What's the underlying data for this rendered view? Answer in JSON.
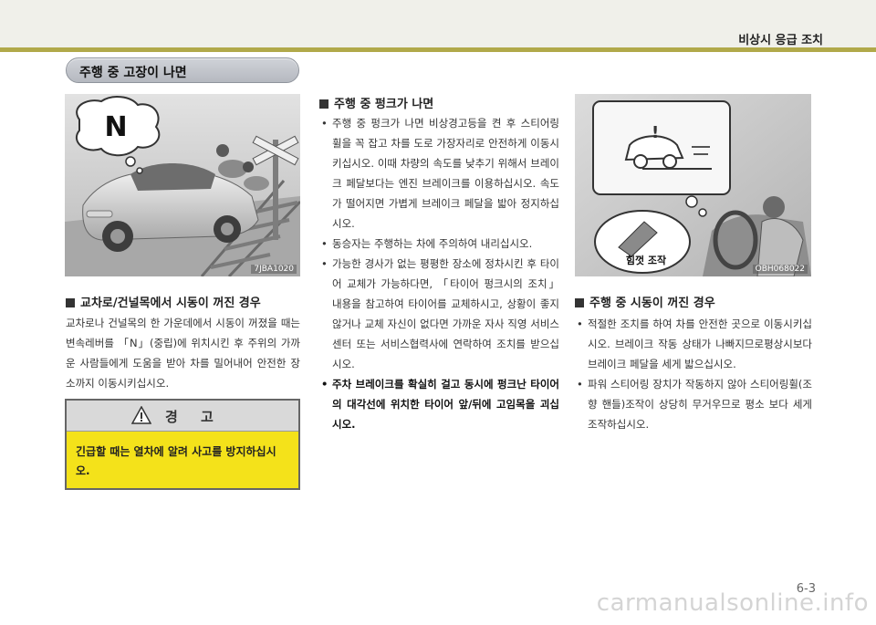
{
  "header": {
    "section_title": "비상시 응급 조치"
  },
  "chapter": {
    "title": "주행 중 고장이 나면"
  },
  "figure1": {
    "caption_letter": "N",
    "code": "7JBA1020"
  },
  "figure2": {
    "caption": "힘껏 조작",
    "code": "OBH068022"
  },
  "left": {
    "heading": "교차로/건널목에서 시동이 꺼진 경우",
    "paragraph": "교차로나 건널목의 한 가운데에서 시동이 꺼졌을 때는 변속레버를 「N」(중립)에 위치시킨 후 주위의 가까운 사람들에게 도움을 받아 차를 밀어내어 안전한 장소까지 이동시키십시오.",
    "warning": {
      "title": "경 고",
      "text": "긴급할 때는 열차에 알려 사고를 방지하십시오."
    }
  },
  "middle": {
    "heading": "주행 중 펑크가 나면",
    "bullets": [
      "주행 중 펑크가 나면 비상경고등을 켠 후 스티어링 휠을 꼭 잡고 차를 도로 가장자리로 안전하게 이동시키십시오. 이때 차량의 속도를 낮추기 위해서 브레이크 페달보다는 엔진 브레이크를 이용하십시오. 속도가 떨어지면 가볍게 브레이크 페달을 밟아 정지하십시오.",
      "동승자는 주행하는 차에 주의하여 내리십시오.",
      "가능한 경사가 없는 평평한 장소에 정차시킨 후 타이어 교체가 가능하다면, 「타이어 펑크시의 조치」 내용을 참고하여 타이어를 교체하시고, 상황이 좋지 않거나 교체 자신이 없다면 가까운 자사 직영 서비스센터 또는 서비스협력사에 연락하여 조치를 받으십시오.",
      "주차 브레이크를 확실히 걸고 동시에 펑크난 타이어의 대각선에 위치한 타이어 앞/뒤에 고임목을 괴십시오."
    ]
  },
  "right": {
    "heading": "주행 중 시동이 꺼진 경우",
    "bullets": [
      "적절한 조치를 하여 차를 안전한 곳으로 이동시키십시오. 브레이크 작동 상태가 나빠지므로평상시보다 브레이크 페달을 세게 밟으십시오.",
      "파워 스티어링 장치가 작동하지 않아 스티어링휠(조향 핸들)조작이 상당히 무거우므로 평소 보다 세게 조작하십시오."
    ]
  },
  "footer": {
    "page_number": "6-3",
    "watermark": "carmanualsonline.info"
  },
  "colors": {
    "header_rule": "#b1a94a",
    "warning_fill": "#f4e21a",
    "pill_fill": "#c4c8ce"
  }
}
